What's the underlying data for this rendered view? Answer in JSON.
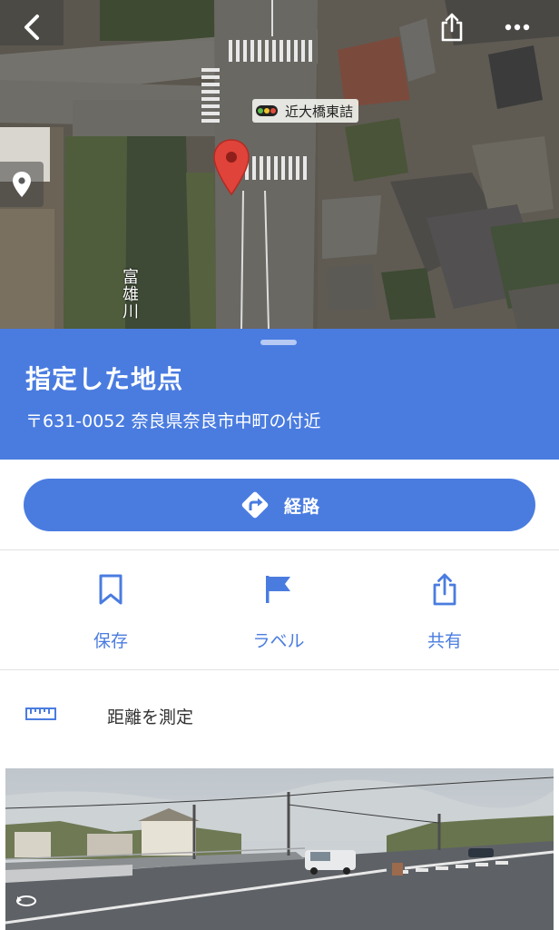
{
  "map": {
    "poi_label": "近大橋東詰",
    "river_label": [
      "富",
      "雄",
      "川"
    ]
  },
  "place": {
    "title": "指定した地点",
    "address": "〒631-0052 奈良県奈良市中町の付近"
  },
  "directions": {
    "label": "経路"
  },
  "actions": {
    "save_label": "保存",
    "label_label": "ラベル",
    "share_label": "共有"
  },
  "measure": {
    "label": "距離を測定"
  },
  "icons": {
    "back": "back-arrow-icon",
    "share": "share-icon",
    "more": "more-horizontal-icon",
    "location": "location-pin-icon",
    "save": "bookmark-icon",
    "label": "flag-icon",
    "ruler": "ruler-icon",
    "street_view": "street-view-rotate-icon"
  },
  "colors": {
    "accent": "#4a7ce0",
    "pin": "#e0433a",
    "divider": "#e2e2e2"
  }
}
